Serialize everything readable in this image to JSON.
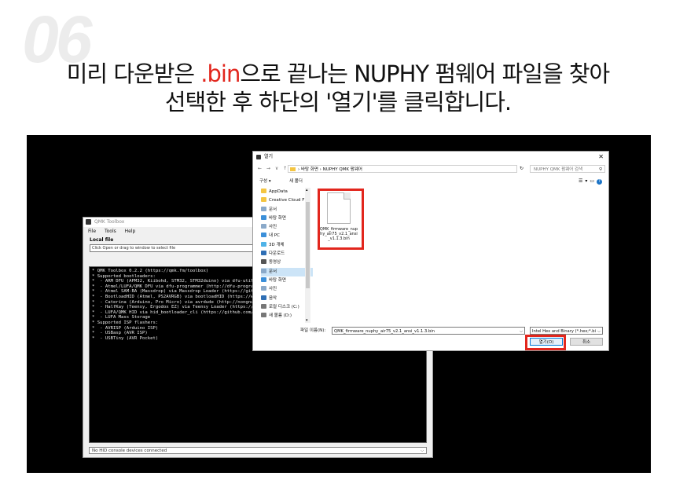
{
  "step_number": "06",
  "headline": {
    "line1_pre": "미리 다운받은 ",
    "line1_accent": ".bin",
    "line1_post": "으로 끝나는 NUPHY 펌웨어 파일을 찾아",
    "line2": "선택한 후 하단의 '열기'를 클릭합니다."
  },
  "colors": {
    "accent": "#e2261d",
    "stage": "#000000"
  },
  "qmk": {
    "title": "QMK Toolbox",
    "menu": [
      "File",
      "Tools",
      "Help"
    ],
    "local_file_label": "Local file",
    "local_file_placeholder": "Click Open or drag to window to select file",
    "console_lines": [
      "* QMK Toolbox 0.2.2 (https://qmk.fm/toolbox)",
      "* Supported bootloaders:",
      "*  - ARM DFU (APM32, Kiibohd, STM32, STM32duino) via dfu-util (",
      "*  - Atmel/LUFA/QMK DFU via dfu-programmer (http://dfu-programm",
      "*  - Atmel SAM-BA (Massdrop) via Massdrop Loader (https://githu",
      "*  - BootloadHID (Atmel, PS2AVRGB) via bootloadHID (https://www",
      "*  - Caterina (Arduino, Pro Micro) via avrdude (http://nongnu.o",
      "*  - HalfKay (Teensy, Ergodox EZ) via Teensy Loader (https://pj",
      "*  - LUFA/QMK HID via hid_bootloader_cli (https://github.com/ab",
      "*  - LUFA Mass Storage",
      "* Supported ISP flashers:",
      "*  - AVRISP (Arduino ISP)",
      "*  - USBasp (AVR ISP)",
      "*  - USBTiny (AVR Pocket)"
    ],
    "status": "No HID console devices connected"
  },
  "dialog": {
    "title": "열기",
    "nav": "← → ∨ ↑",
    "breadcrumb": "› 바탕 화면 › NUPHY QMK 펌웨어",
    "search_placeholder": "NUPHY QMK 펌웨어 검색",
    "organize": "구성 ▾",
    "new_folder": "새 폴더",
    "sidebar": [
      {
        "label": "AppData",
        "icon": "folder-icon",
        "color": "#f4c542"
      },
      {
        "label": "Creative Cloud F",
        "icon": "folder-icon",
        "color": "#f4c542"
      },
      {
        "label": "문서",
        "icon": "documents-icon",
        "color": "#8aa9c9"
      },
      {
        "label": "바탕 화면",
        "icon": "desktop-icon",
        "color": "#3b8fd9"
      },
      {
        "label": "사진",
        "icon": "pictures-icon",
        "color": "#8aa9c9"
      },
      {
        "label": "내 PC",
        "icon": "pc-icon",
        "color": "#3b8fd9"
      },
      {
        "label": "3D 개체",
        "icon": "3d-objects-icon",
        "color": "#4fb3e8"
      },
      {
        "label": "다운로드",
        "icon": "downloads-icon",
        "color": "#2f6fb5"
      },
      {
        "label": "동영상",
        "icon": "videos-icon",
        "color": "#555555"
      },
      {
        "label": "문서",
        "icon": "documents-icon",
        "color": "#8aa9c9"
      },
      {
        "label": "바탕 화면",
        "icon": "desktop-icon",
        "color": "#3b8fd9"
      },
      {
        "label": "사진",
        "icon": "pictures-icon",
        "color": "#8aa9c9"
      },
      {
        "label": "음악",
        "icon": "music-icon",
        "color": "#2f6fb5"
      },
      {
        "label": "로컬 디스크 (C:)",
        "icon": "drive-icon",
        "color": "#777777"
      },
      {
        "label": "새 볼륨 (D:)",
        "icon": "drive-icon",
        "color": "#777777"
      }
    ],
    "file_name": "QMK_firmware_nuphy_air75_v2.1_ansi_v1.1.3.bin",
    "filename_label": "파일 이름(N):",
    "filename_value": "QMK_firmware_nuphy_air75_v2.1_ansi_v1.1.3.bin",
    "filetype_value": "Intel Hex and Binary (*.hex;*.bi",
    "open_label": "열기(O)",
    "cancel_label": "취소"
  }
}
